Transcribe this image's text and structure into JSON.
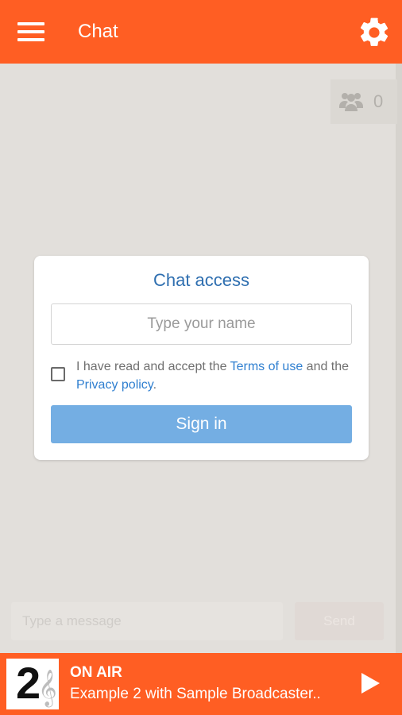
{
  "appbar": {
    "title": "Chat",
    "menu_icon": "hamburger-menu-icon",
    "settings_icon": "gear-icon",
    "color": "#ff5e23"
  },
  "users": {
    "icon": "users-group-icon",
    "count": "0"
  },
  "dialog": {
    "title": "Chat access",
    "name_placeholder": "Type your name",
    "name_value": "",
    "terms_prefix": "I have read and accept the ",
    "terms_link": "Terms of use",
    "terms_middle": " and the ",
    "privacy_link": "Privacy policy",
    "terms_suffix": ".",
    "accepted": false,
    "signin_label": "Sign in",
    "title_color": "#2f6fb0",
    "signin_color": "#74aee3"
  },
  "composer": {
    "placeholder": "Type a message",
    "send_label": "Send"
  },
  "player": {
    "station_number": "2",
    "status": "ON AIR",
    "track": "Example 2 with Sample Broadcaster..",
    "play_icon": "play-icon"
  }
}
